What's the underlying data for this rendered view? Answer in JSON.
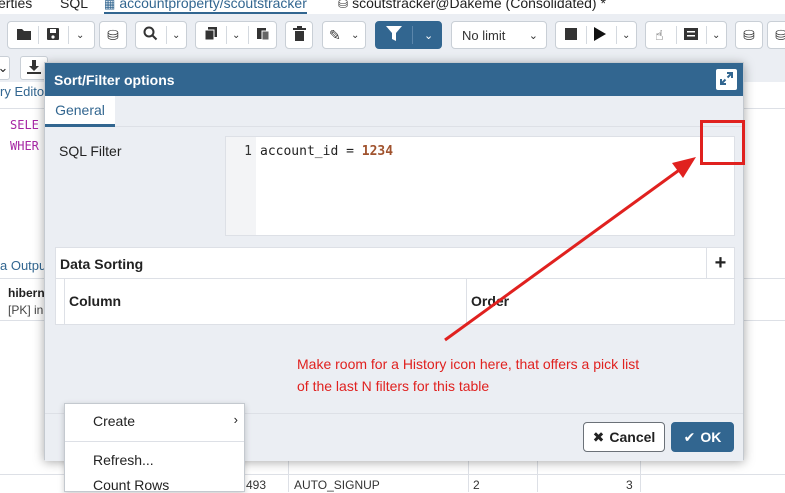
{
  "tabs": [
    {
      "label": "erties"
    },
    {
      "label": "SQL"
    },
    {
      "label": "accountproperty/scoutstracker"
    },
    {
      "label": "scoutstracker@Dakeme (Consolidated) *"
    }
  ],
  "toolbar": {
    "row_limit": "No limit"
  },
  "query_editor": {
    "tab_label": "ry Edito",
    "line1": "SELE",
    "line2": "WHER"
  },
  "output": {
    "tab_label": "a Outpu",
    "col_header": "hiberna",
    "col_sub": "[PK] in",
    "rows": [
      {
        "c1": "493",
        "c2": "AUTO_SIGNUP",
        "c3": "2",
        "c4": "3"
      }
    ]
  },
  "dialog": {
    "title": "Sort/Filter options",
    "tab_general": "General",
    "sql_filter_label": "SQL Filter",
    "line_number": "1",
    "filter_code_prefix": "account_id = ",
    "filter_code_number": "1234",
    "data_sorting_title": "Data Sorting",
    "add_label": "+",
    "column_header": "Column",
    "order_header": "Order",
    "cancel_label": "Cancel",
    "ok_label": "OK"
  },
  "annotation": {
    "line1": "Make room for a History icon here, that offers a pick list",
    "line2": "of the last N filters for this table",
    "color": "#e0211f"
  },
  "context_menu": {
    "items": [
      {
        "label": "Create"
      },
      {
        "label": "Refresh..."
      },
      {
        "label": "Count Rows"
      }
    ]
  },
  "colors": {
    "primary": "#326690",
    "panel_bg": "#ebeef3",
    "annotation_red": "#e0211f"
  },
  "icons": [
    "folder-icon",
    "save-icon",
    "chevron-down-icon",
    "search-icon",
    "copy-icon",
    "paste-icon",
    "trash-icon",
    "edit-icon",
    "filter-icon",
    "stop-icon",
    "play-icon",
    "hand-icon",
    "list-icon",
    "maximize-icon",
    "close-icon",
    "check-icon",
    "download-icon"
  ]
}
